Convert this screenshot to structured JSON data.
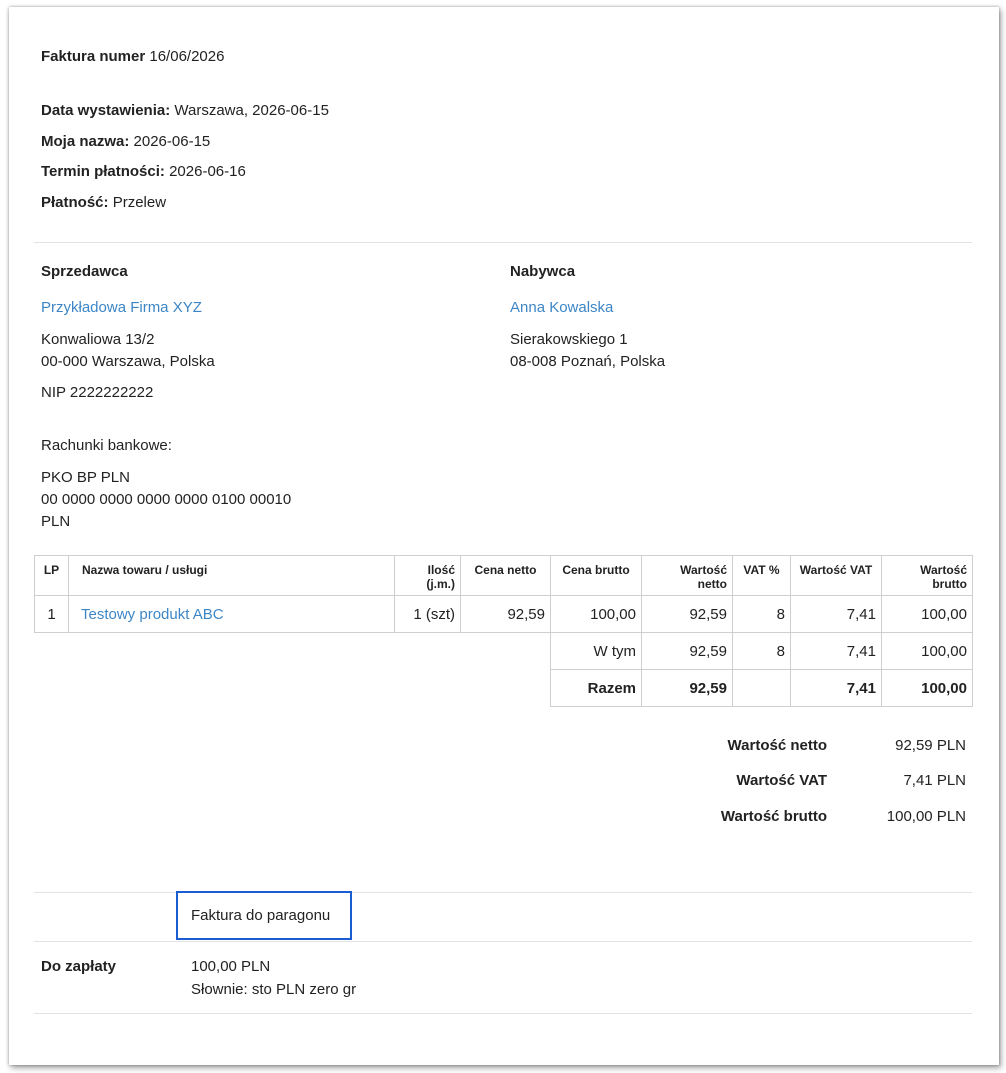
{
  "header": {
    "invoice_label": "Faktura numer",
    "invoice_number": "16/06/2026",
    "fields": [
      {
        "label": "Data wystawienia:",
        "value": "Warszawa, 2026-06-15"
      },
      {
        "label": "Moja nazwa:",
        "value": "2026-06-15"
      },
      {
        "label": "Termin płatności:",
        "value": "2026-06-16"
      },
      {
        "label": "Płatność:",
        "value": "Przelew"
      }
    ]
  },
  "seller": {
    "heading": "Sprzedawca",
    "name": "Przykładowa Firma XYZ",
    "street": "Konwaliowa 13/2",
    "city": "00-000 Warszawa, Polska",
    "nip": "NIP 2222222222",
    "bank_heading": "Rachunki bankowe:",
    "bank_name": "PKO BP PLN",
    "bank_account": "00 0000 0000 0000 0000 0100 00010",
    "bank_currency": "PLN"
  },
  "buyer": {
    "heading": "Nabywca",
    "name": "Anna Kowalska",
    "street": "Sierakowskiego 1",
    "city": "08-008 Poznań, Polska"
  },
  "table": {
    "headers": {
      "lp": "LP",
      "name": "Nazwa towaru / usługi",
      "qty_1": "Ilość",
      "qty_2": "(j.m.)",
      "net_price": "Cena netto",
      "gross_price": "Cena brutto",
      "net_value_1": "Wartość",
      "net_value_2": "netto",
      "vat_pct": "VAT %",
      "vat_value": "Wartość VAT",
      "gross_value_1": "Wartość",
      "gross_value_2": "brutto"
    },
    "rows": [
      {
        "lp": "1",
        "name": "Testowy produkt ABC",
        "qty": "1 (szt)",
        "net_price": "92,59",
        "gross_price": "100,00",
        "net_value": "92,59",
        "vat_pct": "8",
        "vat_value": "7,41",
        "gross_value": "100,00"
      }
    ],
    "subtotal": {
      "label": "W tym",
      "net_value": "92,59",
      "vat_pct": "8",
      "vat_value": "7,41",
      "gross_value": "100,00"
    },
    "total": {
      "label": "Razem",
      "net_value": "92,59",
      "vat_value": "7,41",
      "gross_value": "100,00"
    }
  },
  "summary": [
    {
      "label": "Wartość netto",
      "value": "92,59 PLN"
    },
    {
      "label": "Wartość VAT",
      "value": "7,41 PLN"
    },
    {
      "label": "Wartość brutto",
      "value": "100,00 PLN"
    }
  ],
  "note": "Faktura do paragonu",
  "payment": {
    "label": "Do zapłaty",
    "amount": "100,00 PLN",
    "words": "Słownie: sto PLN zero gr"
  },
  "colors": {
    "link": "#3d86c6",
    "highlight": "#1a5cd1"
  }
}
